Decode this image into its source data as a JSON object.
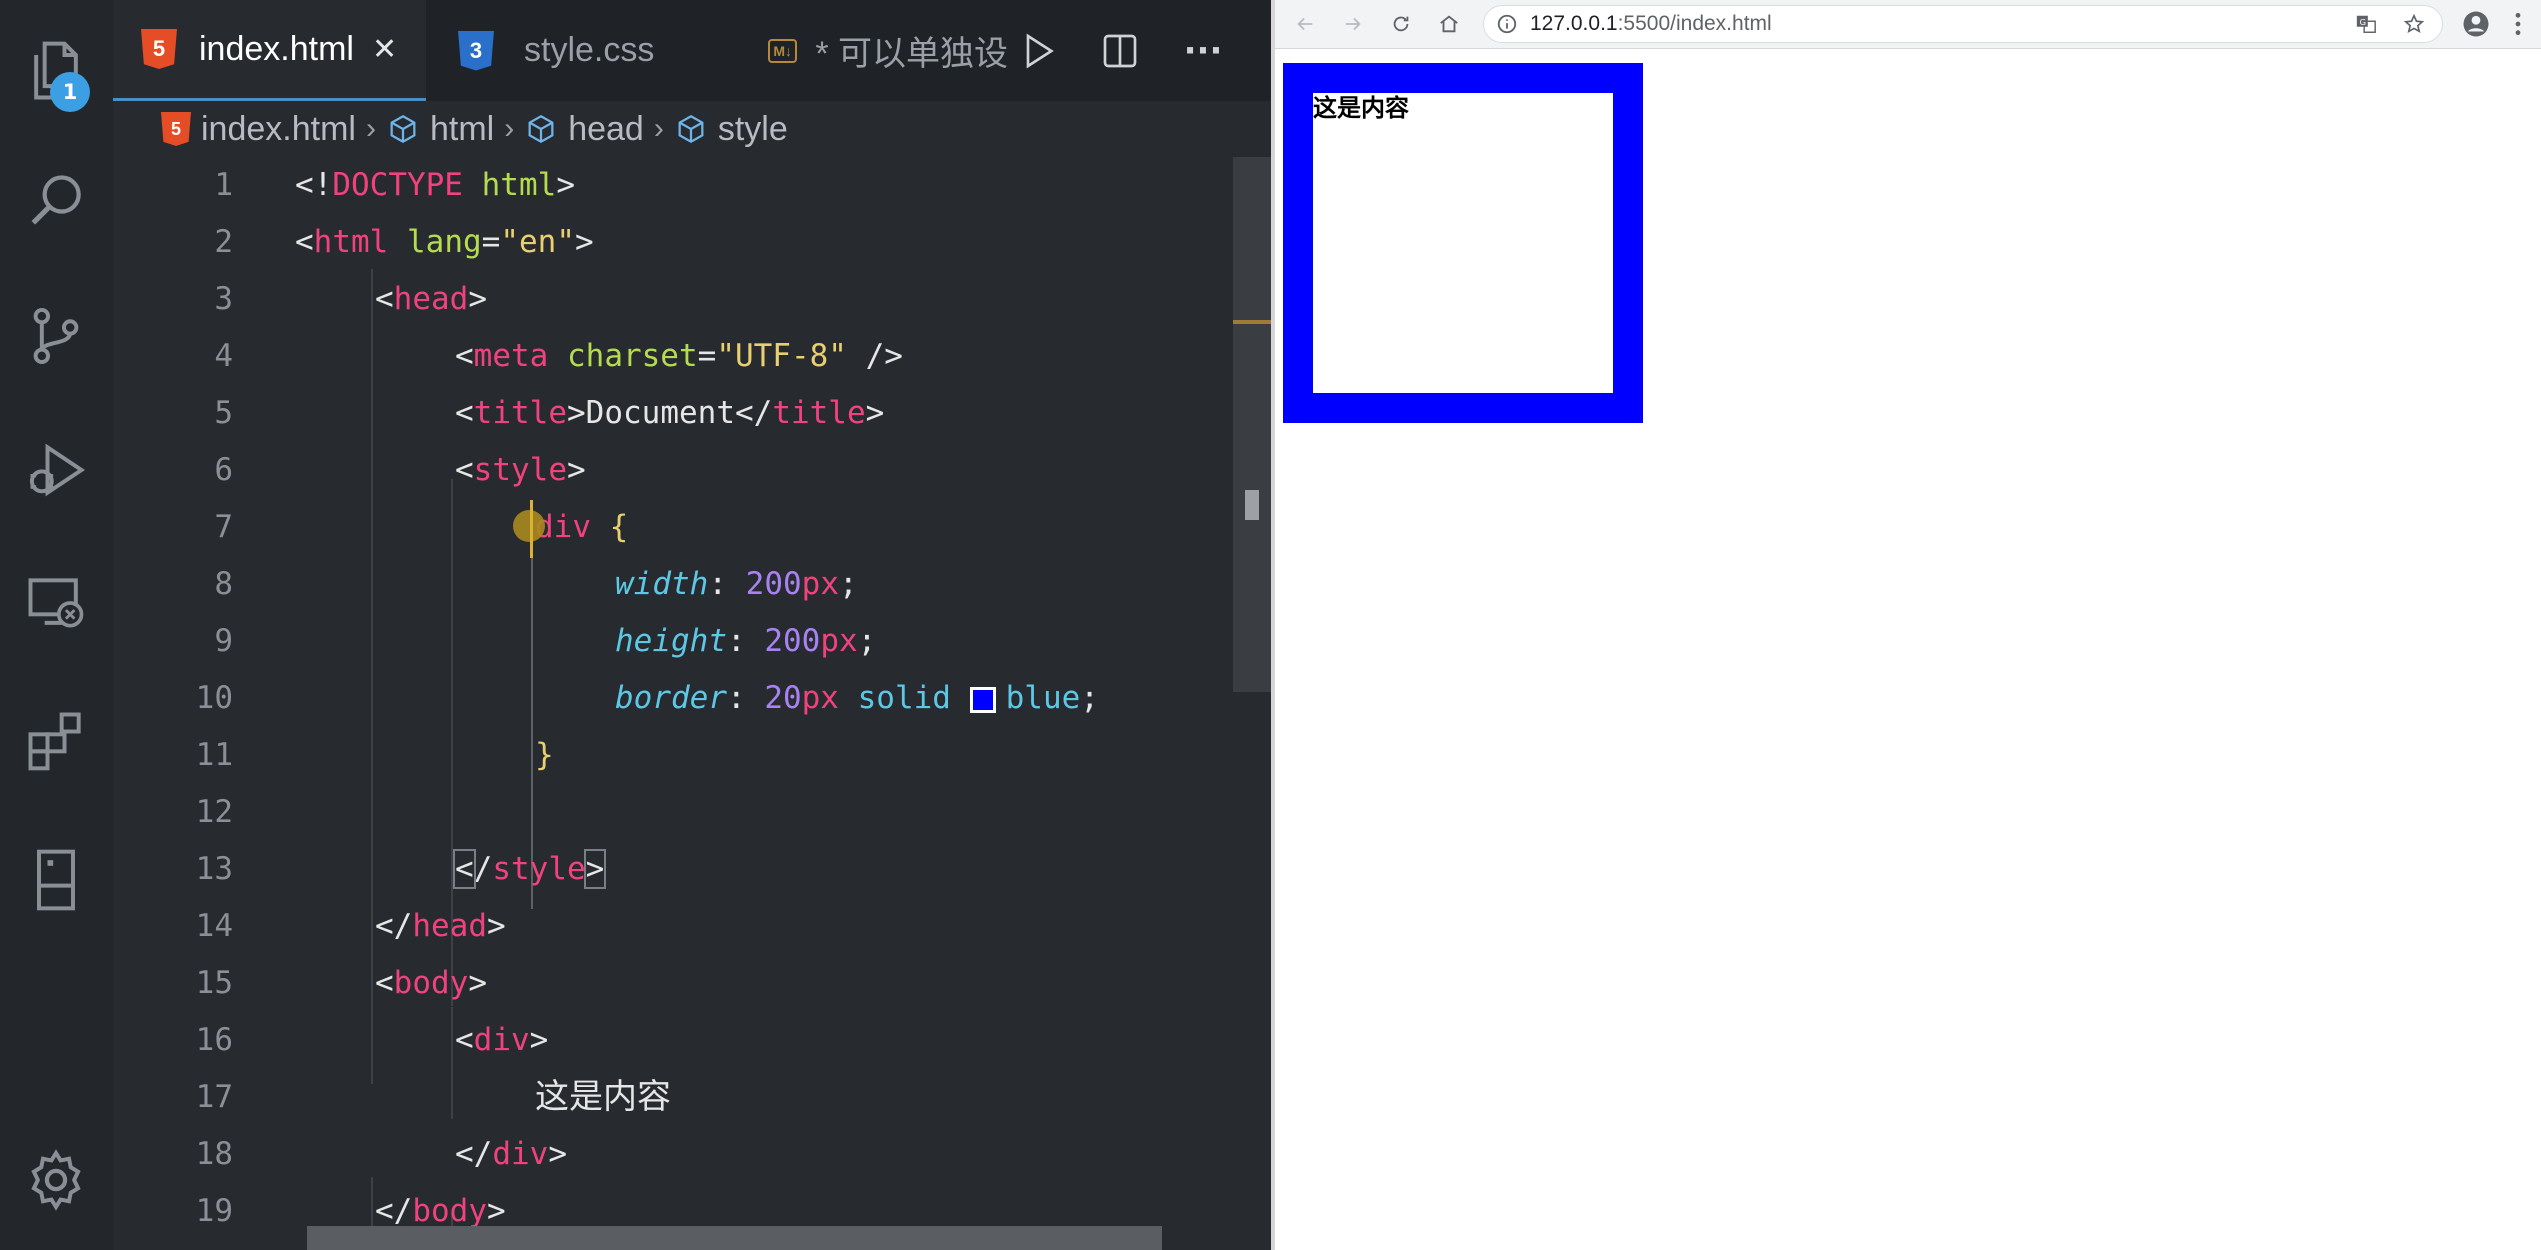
{
  "editor": {
    "tabs": [
      {
        "label": "index.html",
        "icon": "html5-icon",
        "active": true,
        "close": "✕"
      },
      {
        "label": "style.css",
        "icon": "css3-icon",
        "active": false
      },
      {
        "label": "* 可以单独设",
        "icon": "markdown-icon",
        "active": false
      }
    ],
    "badge_count": "1",
    "breadcrumb": [
      "index.html",
      "html",
      "head",
      "style"
    ],
    "line_numbers": [
      "1",
      "2",
      "3",
      "4",
      "5",
      "6",
      "7",
      "8",
      "9",
      "10",
      "11",
      "12",
      "13",
      "14",
      "15",
      "16",
      "17",
      "18",
      "19"
    ],
    "code": {
      "l1": {
        "a": "<!",
        "b": "DOCTYPE",
        "c": " html",
        "d": ">"
      },
      "l2": {
        "a": "<",
        "b": "html",
        "c": " lang",
        "d": "=",
        "e": "\"en\"",
        "f": ">"
      },
      "l3": {
        "a": "<",
        "b": "head",
        "c": ">"
      },
      "l4": {
        "a": "<",
        "b": "meta",
        "c": " charset",
        "d": "=",
        "e": "\"UTF-8\"",
        "f": " />"
      },
      "l5": {
        "a": "<",
        "b": "title",
        "c": ">",
        "d": "Document",
        "e": "</",
        "f": "title",
        "g": ">"
      },
      "l6": {
        "a": "<",
        "b": "style",
        "c": ">"
      },
      "l7": {
        "a": "div",
        "b": " {"
      },
      "l8": {
        "a": "width",
        "b": ": ",
        "c": "200",
        "d": "px",
        "e": ";"
      },
      "l9": {
        "a": "height",
        "b": ": ",
        "c": "200",
        "d": "px",
        "e": ";"
      },
      "l10": {
        "a": "border",
        "b": ": ",
        "c": "20",
        "d": "px",
        "e": " solid ",
        "f": "blue",
        "g": ";"
      },
      "l11": {
        "a": "}"
      },
      "l13": {
        "a": "<",
        "b": "/",
        "c": "style",
        "d": ">"
      },
      "l14": {
        "a": "</",
        "b": "head",
        "c": ">"
      },
      "l15": {
        "a": "<",
        "b": "body",
        "c": ">"
      },
      "l16": {
        "a": "<",
        "b": "div",
        "c": ">"
      },
      "l17": {
        "a": "这是内容"
      },
      "l18": {
        "a": "</",
        "b": "div",
        "c": ">"
      },
      "l19": {
        "a": "</",
        "b": "body",
        "c": ">"
      }
    }
  },
  "browser": {
    "url_host": "127.0.0.1",
    "url_rest": ":5500/index.html",
    "box_text": "这是内容"
  },
  "colors": {
    "editor_bg": "#272a2e",
    "tag": "#f0437d",
    "attr": "#b4dc50",
    "string": "#e8d070",
    "property": "#5dc7e6",
    "number": "#a882f0",
    "box_border": "#0000ff"
  }
}
